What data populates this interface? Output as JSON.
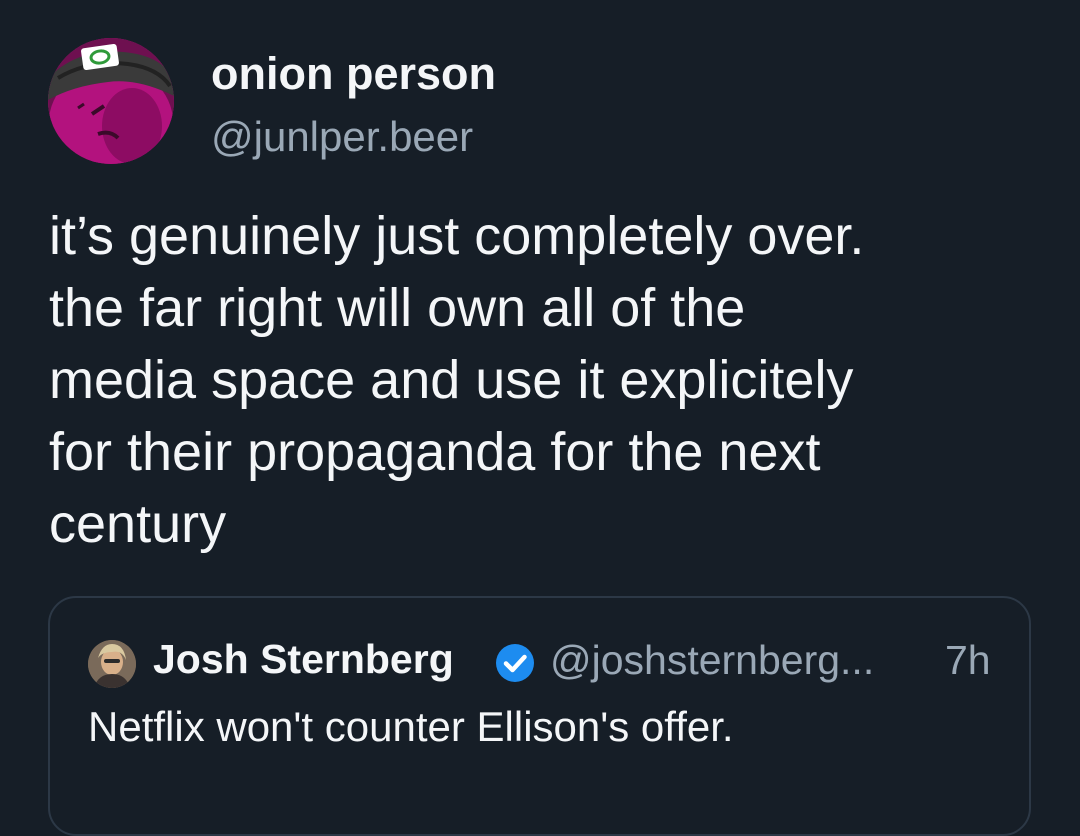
{
  "post": {
    "author": {
      "display_name": "onion person",
      "handle": "@junlper.beer",
      "avatar_icon": "onion-character-avatar"
    },
    "text_lines": [
      "it’s genuinely just completely over.",
      "the far right will own all of the",
      "media space and use it explicitely",
      "for their propaganda for the next",
      "century"
    ]
  },
  "quote": {
    "author": {
      "display_name": "Josh Sternberg",
      "handle": "@joshsternberg...",
      "verified_icon": "verified-check-icon",
      "avatar_icon": "profile-photo-avatar"
    },
    "timestamp": "7h",
    "text": "Netflix won't counter Ellison's offer."
  },
  "colors": {
    "background": "#161e27",
    "primary_text": "#f4f6f8",
    "secondary_text": "#9aa8b6",
    "border": "#2c3846",
    "verified": "#1d8cf0",
    "avatar_accent": "#c21a8a"
  }
}
